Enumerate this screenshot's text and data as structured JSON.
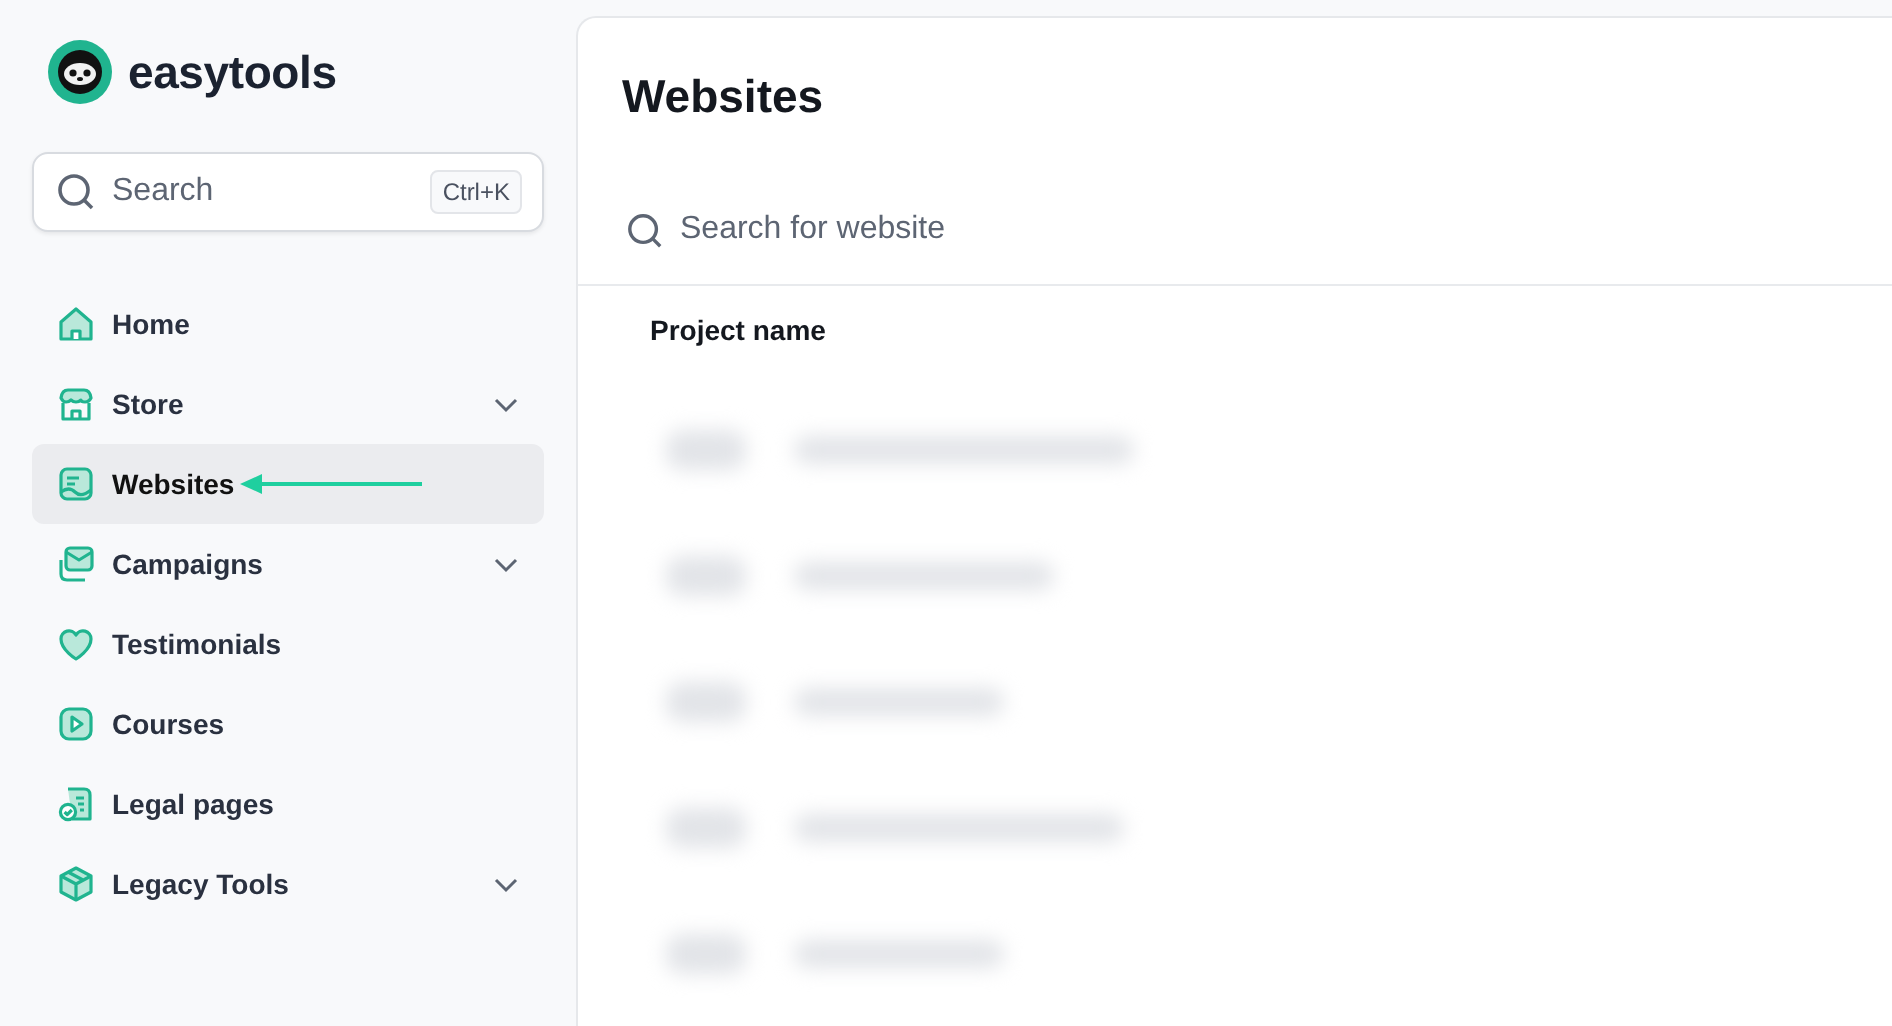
{
  "brand": {
    "name": "easytools"
  },
  "search": {
    "placeholder": "Search",
    "shortcut": "Ctrl+K"
  },
  "nav": [
    {
      "label": "Home",
      "selected": false,
      "expandable": false,
      "annotated": false
    },
    {
      "label": "Store",
      "selected": false,
      "expandable": true,
      "annotated": false
    },
    {
      "label": "Websites",
      "selected": true,
      "expandable": false,
      "annotated": true
    },
    {
      "label": "Campaigns",
      "selected": false,
      "expandable": true,
      "annotated": false
    },
    {
      "label": "Testimonials",
      "selected": false,
      "expandable": false,
      "annotated": false
    },
    {
      "label": "Courses",
      "selected": false,
      "expandable": false,
      "annotated": false
    },
    {
      "label": "Legal pages",
      "selected": false,
      "expandable": false,
      "annotated": false
    },
    {
      "label": "Legacy Tools",
      "selected": false,
      "expandable": true,
      "annotated": false
    }
  ],
  "page": {
    "title": "Websites",
    "search_placeholder": "Search for website"
  },
  "table": {
    "columns": [
      "Project name"
    ],
    "rows": [
      {
        "kind": "blurred"
      },
      {
        "kind": "blurred"
      },
      {
        "kind": "blurred"
      },
      {
        "kind": "blurred"
      },
      {
        "kind": "blurred"
      }
    ]
  }
}
